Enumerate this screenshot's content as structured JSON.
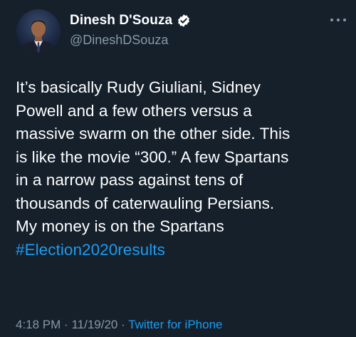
{
  "author": {
    "display_name": "Dinesh D'Souza",
    "handle": "@DineshDSouza",
    "verified": true
  },
  "tweet": {
    "lines": [
      "It’s basically Rudy Giuliani, Sidney",
      "Powell and a few others versus a",
      "massive swarm on the other side. This",
      "is like the movie “300.” A few Spartans",
      "in a narrow pass against tens of",
      "thousands of caterwauling Persians.",
      "My money is on the Spartans"
    ],
    "hashtag": "#Election2020results"
  },
  "meta": {
    "time": "4:18 PM",
    "separator": "·",
    "date": "11/19/20",
    "source": "Twitter for iPhone"
  },
  "icons": {
    "verified": "verified-badge-icon",
    "more": "more-options-icon"
  },
  "colors": {
    "background": "#15202b",
    "link": "#1d9bf0",
    "secondary_text": "#8899a6"
  }
}
